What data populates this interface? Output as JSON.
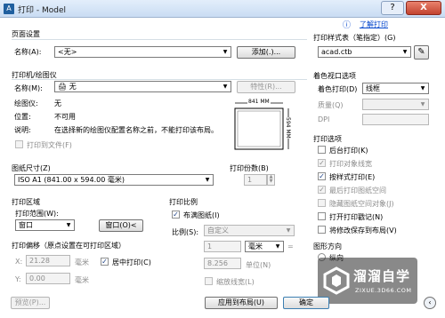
{
  "title": "打印 - Model",
  "titlebar": {
    "help": "?",
    "close": "X"
  },
  "page_setup": {
    "group_title": "页面设置",
    "name_label": "名称(A):",
    "name_value": "<无>",
    "add_button": "添加(.)..."
  },
  "help_link": "了解打印",
  "printer": {
    "group_title": "打印机/绘图仪",
    "name_label": "名称(M):",
    "name_value": "无",
    "properties_button": "特性(R)...",
    "plotter_label": "绘图仪:",
    "plotter_value": "无",
    "location_label": "位置:",
    "location_value": "不可用",
    "description_label": "说明:",
    "description_value": "在选择新的绘图仪配置名称之前，不能打印该布局。",
    "print_to_file": "打印到文件(F)",
    "preview_width": "841 MM",
    "preview_height": "594 MM"
  },
  "paper_size": {
    "group_title": "图纸尺寸(Z)",
    "value": "ISO A1 (841.00 x 594.00 毫米)"
  },
  "copies": {
    "label": "打印份数(B)",
    "value": "1"
  },
  "print_area": {
    "group_title": "打印区域",
    "range_label": "打印范围(W):",
    "range_value": "窗口",
    "window_button": "窗口(O)<"
  },
  "print_offset": {
    "group_title": "打印偏移（原点设置在可打印区域）",
    "x_label": "X:",
    "x_value": "21.28",
    "x_unit": "毫米",
    "center_label": "居中打印(C)",
    "y_label": "Y:",
    "y_value": "0.00",
    "y_unit": "毫米"
  },
  "print_scale": {
    "group_title": "打印比例",
    "fit_paper": "布满图纸(I)",
    "scale_label": "比例(S):",
    "scale_value": "自定义",
    "value1": "1",
    "unit1": "毫米",
    "value2": "8.256",
    "unit2": "单位(N)",
    "lineweights": "缩放线宽(L)"
  },
  "plot_style": {
    "group_title": "打印样式表（笔指定）(G)",
    "value": "acad.ctb"
  },
  "viewport": {
    "group_title": "着色视口选项",
    "shade_label": "着色打印(D)",
    "shade_value": "线框",
    "quality_label": "质量(Q)",
    "dpi_label": "DPI"
  },
  "options": {
    "group_title": "打印选项",
    "items": [
      {
        "label": "后台打印(K)",
        "checked": false,
        "disabled": false
      },
      {
        "label": "打印对象线宽",
        "checked": true,
        "disabled": true
      },
      {
        "label": "按样式打印(E)",
        "checked": true,
        "disabled": false
      },
      {
        "label": "最后打印图纸空间",
        "checked": true,
        "disabled": true
      },
      {
        "label": "隐藏图纸空间对象(J)",
        "checked": false,
        "disabled": true
      },
      {
        "label": "打开打印戳记(N)",
        "checked": false,
        "disabled": false
      },
      {
        "label": "将修改保存到布局(V)",
        "checked": false,
        "disabled": false
      }
    ]
  },
  "orientation": {
    "group_title": "图形方向",
    "portrait": "纵向"
  },
  "footer": {
    "preview_button": "预览(P)...",
    "apply_button": "应用到布局(U)",
    "ok_button": "确定"
  },
  "watermark": {
    "title": "溜溜自学",
    "url": "ZIXUE.3D66.COM"
  },
  "colors": {
    "link": "#0044cc",
    "titlebar": "#c9dcf3",
    "close": "#c24330"
  }
}
